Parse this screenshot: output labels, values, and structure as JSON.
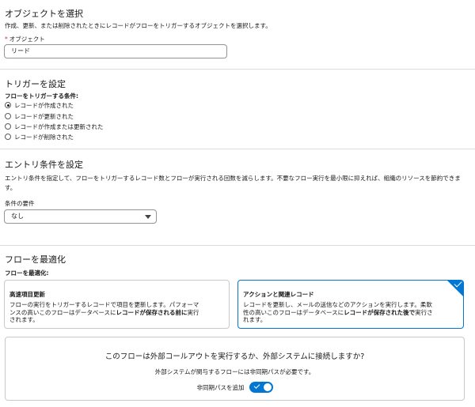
{
  "object_section": {
    "title": "オブジェクトを選択",
    "description": "作成、更新、または削除されたときにレコードがフローをトリガーするオブジェクトを選択します。",
    "field_required_mark": "*",
    "field_label": "オブジェクト",
    "field_value": "リード"
  },
  "trigger_section": {
    "title": "トリガーを設定",
    "label": "フローをトリガーする条件:",
    "options": [
      {
        "label": "レコードが作成された",
        "selected": true
      },
      {
        "label": "レコードが更新された",
        "selected": false
      },
      {
        "label": "レコードが作成または更新された",
        "selected": false
      },
      {
        "label": "レコードが削除された",
        "selected": false
      }
    ]
  },
  "entry_section": {
    "title": "エントリ条件を設定",
    "description_line1": "エントリ条件を指定して、フローをトリガーするレコード数とフローが実行される回数を減らします。不要なフロー実行を最小限に抑えれば、組織のリソースを節約できま",
    "description_line2": "す。",
    "condition_label": "条件の要件",
    "condition_value": "なし"
  },
  "optimize_section": {
    "title": "フローを最適化",
    "label": "フローを最適化:",
    "cards": [
      {
        "title": "高速項目更新",
        "desc_1": "フローの実行をトリガーするレコードで項目を更新します。パフォーマ",
        "desc_2": "ンスの高いこのフローはデータベースに",
        "desc_bold": "レコードが保存される前に",
        "desc_3": "実行",
        "desc_4": "されます。",
        "selected": false
      },
      {
        "title": "アクションと関連レコード",
        "desc_1": "レコードを更新し、メールの送信などのアクションを実行します。柔軟",
        "desc_2": "性の高いこのフローはデータベースに",
        "desc_bold": "レコードが保存された後で",
        "desc_3": "実行さ",
        "desc_4": "れます。",
        "selected": true
      }
    ]
  },
  "async_box": {
    "question": "このフローは外部コールアウトを実行するか、外部システムに接続しますか?",
    "subtext": "外部システムが関与するフローには非同期パスが必要です。",
    "toggle_label": "非同期パスを追加",
    "toggle_on": true
  },
  "colors": {
    "accent": "#0176d3",
    "required": "#c23934",
    "divider": "#dddbda"
  }
}
